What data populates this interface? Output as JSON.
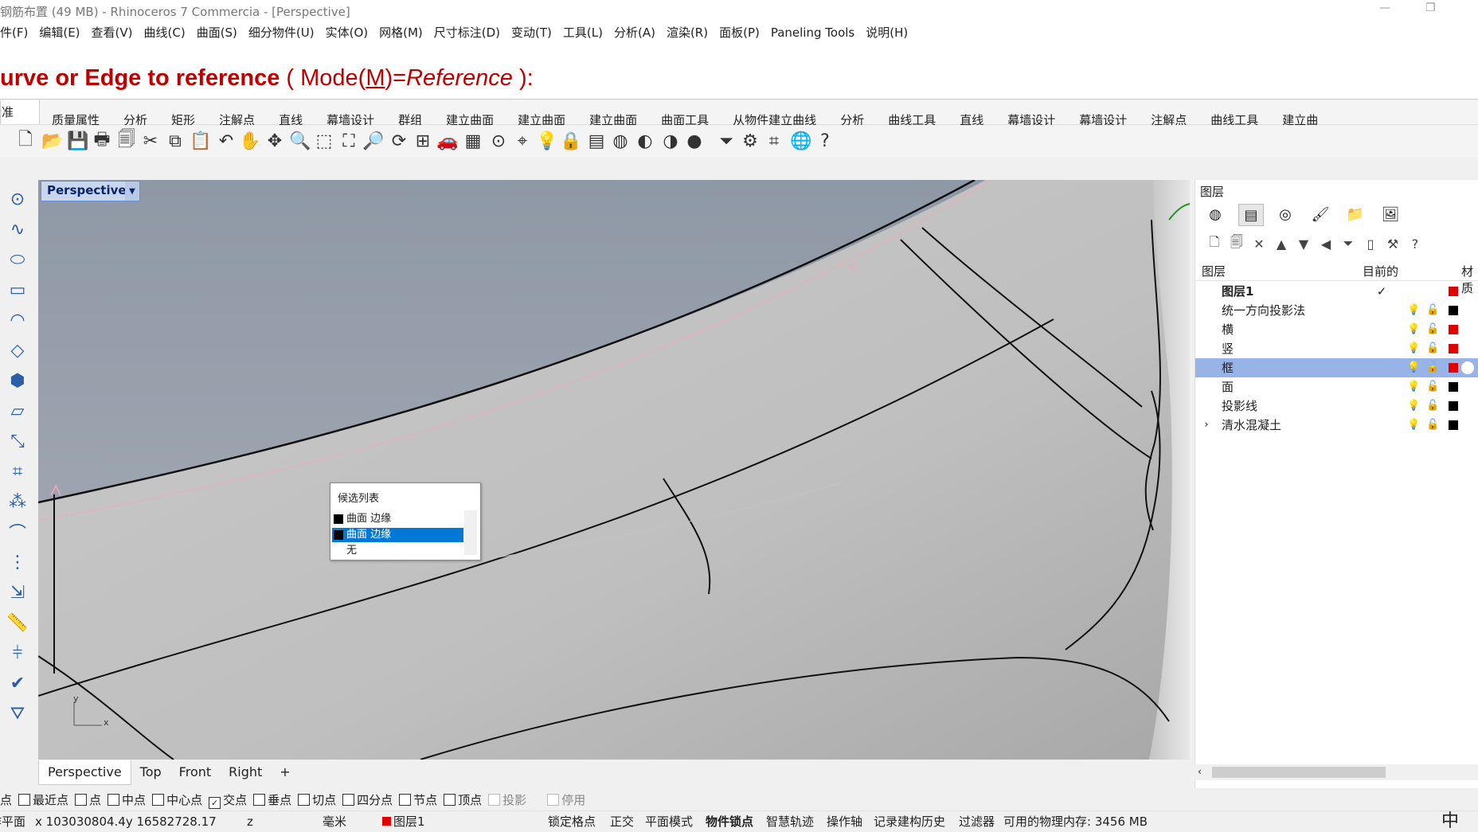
{
  "window": {
    "title": "钢筋布置 (49 MB) - Rhinoceros 7 Commercia - [Perspective]",
    "minimize_icon": "minimize-icon",
    "restore_icon": "restore-icon"
  },
  "menu": [
    "件(F)",
    "编辑(E)",
    "查看(V)",
    "曲线(C)",
    "曲面(S)",
    "细分物件(U)",
    "实体(O)",
    "网格(M)",
    "尺寸标注(D)",
    "变动(T)",
    "工具(L)",
    "分析(A)",
    "渲染(R)",
    "面板(P)",
    "Paneling Tools",
    "说明(H)"
  ],
  "command_prompt": {
    "lead": "urve or Edge to reference",
    "open": " ( Mode(",
    "key": "M",
    "eq": ")=",
    "value": "Reference",
    "close": " ):"
  },
  "ribbon_tabs": [
    "标准",
    "质量属性",
    "分析",
    "矩形",
    "注解点",
    "直线",
    "幕墙设计",
    "群组",
    "建立曲面",
    "建立曲面",
    "建立曲面",
    "曲面工具",
    "从物件建立曲线",
    "分析",
    "曲线工具",
    "直线",
    "幕墙设计",
    "幕墙设计",
    "注解点",
    "曲线工具",
    "建立曲"
  ],
  "toolbar_icons": [
    "new-icon",
    "open-icon",
    "save-icon",
    "print-icon",
    "template-icon",
    "cut-icon",
    "copy-icon",
    "paste-icon",
    "undo-icon",
    "pan-icon",
    "rotate-view-icon",
    "zoom-icon",
    "zoom-window-icon",
    "zoom-extents-icon",
    "zoom-selected-icon",
    "rotate-icon",
    "viewport-layout-icon",
    "car-icon",
    "grid-icon",
    "point-icon",
    "snap-icon",
    "light-icon",
    "lock-icon",
    "layer-icon",
    "color-wheel-icon",
    "shaded-sphere-icon",
    "rendered-sphere-icon",
    "blue-sphere-icon",
    "filter-icon",
    "gear-icon",
    "dimension-icon",
    "globe-icon",
    "help-icon"
  ],
  "left_tools": [
    "point-icon",
    "curve-icon",
    "ellipse-icon",
    "rectangle-icon",
    "arc-icon",
    "surface-icon",
    "solid-icon",
    "mesh-icon",
    "transform-icon",
    "dimension-icon",
    "group-icon",
    "fillet-icon",
    "array-icon",
    "project-icon",
    "measure-icon",
    "split-icon",
    "check-icon",
    "lamp-icon"
  ],
  "viewport": {
    "label": "Perspective",
    "axis_x": "x",
    "axis_y": "y",
    "candidate_popup": {
      "title": "候选列表",
      "items": [
        {
          "label": "曲面 边缘",
          "selected": false
        },
        {
          "label": "曲面 边缘",
          "selected": true
        },
        {
          "label": "无",
          "selected": false
        }
      ]
    }
  },
  "viewport_tabs": [
    "Perspective",
    "Top",
    "Front",
    "Right"
  ],
  "add_tab_icon": "plus-icon",
  "layers_panel": {
    "title": "图层",
    "tab_icons": [
      "color-wheel-icon",
      "layers-icon",
      "render-icon",
      "brush-icon",
      "folder-icon",
      "image-icon"
    ],
    "action_icons": [
      "new-layer-icon",
      "new-sublayer-icon",
      "delete-icon",
      "move-up-icon",
      "move-down-icon",
      "move-left-icon",
      "filter-icon",
      "page-icon",
      "tools-icon",
      "help-icon"
    ],
    "columns": {
      "name": "图层",
      "current": "目前的",
      "material": "材质"
    },
    "layers": [
      {
        "name": "图层1",
        "current": true,
        "color": "#e00000",
        "bold": true,
        "selected": false,
        "expandable": false
      },
      {
        "name": "统一方向投影法",
        "current": false,
        "color": "#000000",
        "bold": false,
        "selected": false,
        "expandable": false
      },
      {
        "name": "横",
        "current": false,
        "color": "#e00000",
        "bold": false,
        "selected": false,
        "expandable": false
      },
      {
        "name": "竖",
        "current": false,
        "color": "#e00000",
        "bold": false,
        "selected": false,
        "expandable": false
      },
      {
        "name": "框",
        "current": false,
        "color": "#e00000",
        "bold": false,
        "selected": true,
        "expandable": false
      },
      {
        "name": "面",
        "current": false,
        "color": "#000000",
        "bold": false,
        "selected": false,
        "expandable": false
      },
      {
        "name": "投影线",
        "current": false,
        "color": "#000000",
        "bold": false,
        "selected": false,
        "expandable": false
      },
      {
        "name": "清水混凝土",
        "current": false,
        "color": "#000000",
        "bold": false,
        "selected": false,
        "expandable": true
      }
    ]
  },
  "osnaps": [
    {
      "label": "端点",
      "checked": null
    },
    {
      "label": "最近点",
      "checked": false
    },
    {
      "label": "点",
      "checked": false
    },
    {
      "label": "中点",
      "checked": false
    },
    {
      "label": "中心点",
      "checked": false
    },
    {
      "label": "交点",
      "checked": true
    },
    {
      "label": "垂点",
      "checked": false
    },
    {
      "label": "切点",
      "checked": false
    },
    {
      "label": "四分点",
      "checked": false
    },
    {
      "label": "节点",
      "checked": false
    },
    {
      "label": "顶点",
      "checked": false
    },
    {
      "label": "投影",
      "checked": false,
      "disabled": true
    },
    {
      "label": "停用",
      "checked": false,
      "disabled": true
    }
  ],
  "status": {
    "cplane": "工作平面",
    "coords": "x 103030804.4y 16582728.17",
    "z": "z",
    "units": "毫米",
    "layer": "图层1",
    "layer_color": "#e00000",
    "grid_snap": "锁定格点",
    "ortho": "正交",
    "planar": "平面模式",
    "osnap": "物件锁点",
    "smart_track": "智慧轨迹",
    "gumball": "操作轴",
    "history": "记录建构历史",
    "filter": "过滤器",
    "memory": "可用的物理内存: 3456 MB",
    "ime": "中"
  }
}
